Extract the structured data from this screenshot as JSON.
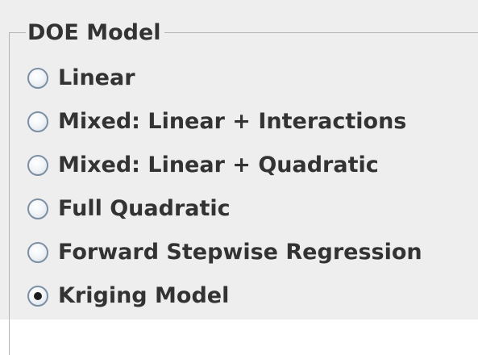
{
  "group": {
    "title": "DOE Model",
    "options": [
      {
        "label": "Linear",
        "selected": false
      },
      {
        "label": "Mixed: Linear + Interactions",
        "selected": false
      },
      {
        "label": "Mixed: Linear + Quadratic",
        "selected": false
      },
      {
        "label": "Full Quadratic",
        "selected": false
      },
      {
        "label": "Forward Stepwise Regression",
        "selected": false
      },
      {
        "label": "Kriging Model",
        "selected": true
      }
    ]
  },
  "colors": {
    "background": "#eeeeee",
    "text": "#333333",
    "border": "#b5b5b5",
    "radio_border": "#7d8fa3"
  }
}
